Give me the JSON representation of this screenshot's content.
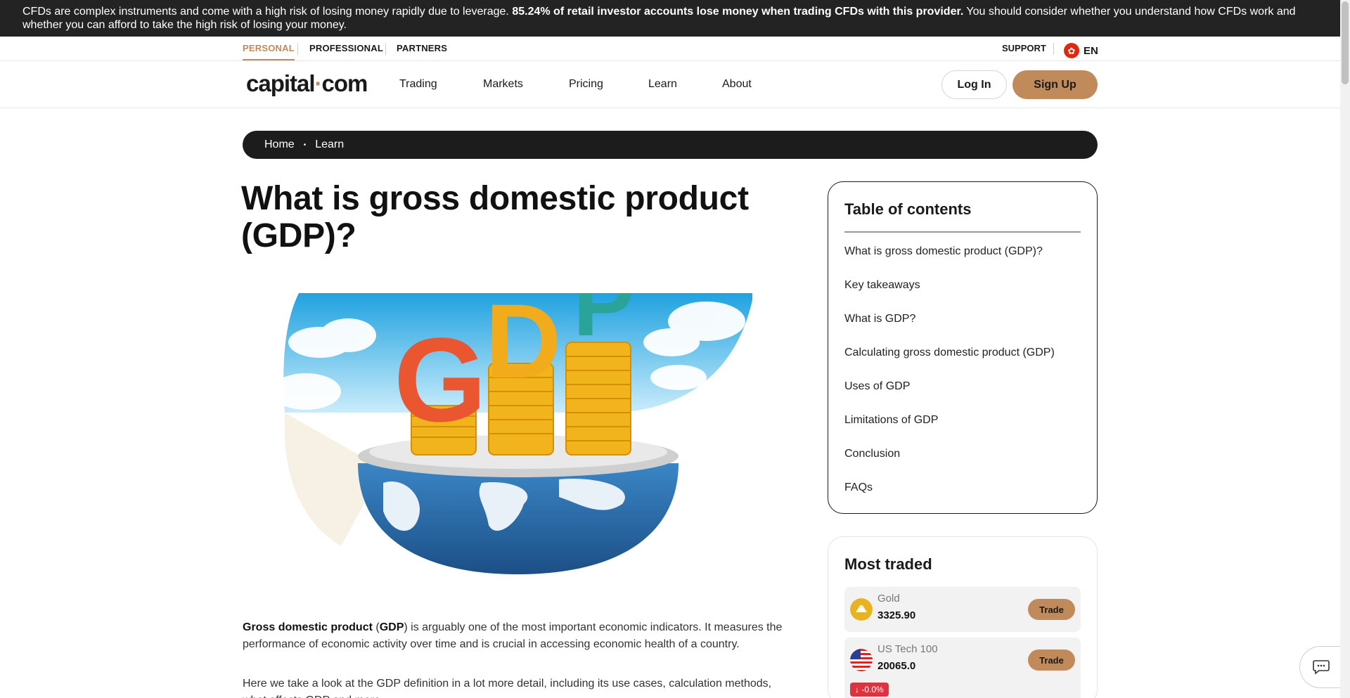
{
  "risk_banner": {
    "text_before": "CFDs are complex instruments and come with a high risk of losing money rapidly due to leverage. ",
    "text_bold": "85.24% of retail investor accounts lose money when trading CFDs with this provider.",
    "text_after": " You should consider whether you understand how CFDs work and whether you can afford to take the high risk of losing your money."
  },
  "segments": {
    "personal": "PERSONAL",
    "professional": "PROFESSIONAL",
    "partners": "PARTNERS"
  },
  "support": "SUPPORT",
  "language": "EN",
  "logo": {
    "left": "capital",
    "dot": "·",
    "right": "com"
  },
  "nav": {
    "trading": "Trading",
    "markets": "Markets",
    "pricing": "Pricing",
    "learn": "Learn",
    "about": "About"
  },
  "auth": {
    "login": "Log In",
    "signup": "Sign Up"
  },
  "breadcrumb": {
    "home": "Home",
    "sep": "•",
    "learn": "Learn"
  },
  "article": {
    "title": "What is gross domestic product (GDP)?",
    "hero_letters": [
      "G",
      "D",
      "P"
    ],
    "p1_bold": "Gross domestic product",
    "p1_paren_open": " (",
    "p1_abbr": "GDP",
    "p1_rest": ") is arguably one of the most important economic indicators. It measures the performance of economic activity over time and is crucial in accessing economic health of a country.",
    "p2": "Here we take a look at the GDP definition in a lot more detail, including its use cases, calculation methods, what affects GDP and more."
  },
  "toc": {
    "title": "Table of contents",
    "items": [
      "What is gross domestic product (GDP)?",
      "Key takeaways",
      "What is GDP?",
      "Calculating gross domestic product (GDP)",
      "Uses of GDP",
      "Limitations of GDP",
      "Conclusion",
      "FAQs"
    ]
  },
  "most_traded": {
    "title": "Most traded",
    "trade_label": "Trade",
    "items": [
      {
        "name": "Gold",
        "price": "3325.90"
      },
      {
        "name": "US Tech 100",
        "price": "20065.0",
        "change": "↓ -0.0%"
      }
    ]
  },
  "colors": {
    "accent": "#c08a5b",
    "banner_bg": "#232323",
    "negative": "#e0313f"
  }
}
